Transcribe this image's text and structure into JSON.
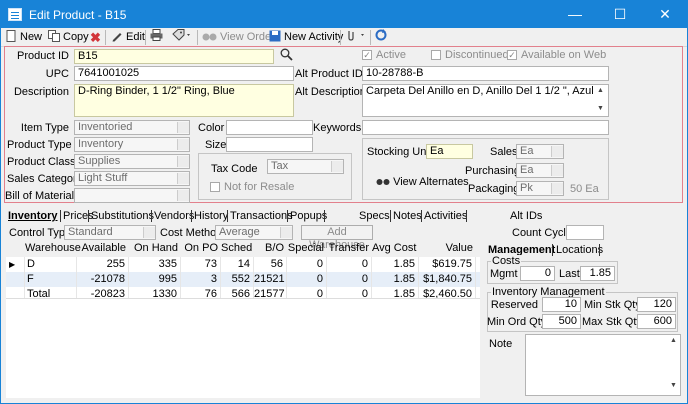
{
  "window": {
    "title": "Edit Product - B15",
    "minimize": "—",
    "maximize": "☐",
    "close": "✕"
  },
  "toolbar": {
    "new": "New",
    "copy": "Copy",
    "edit": "Edit",
    "view_order": "View Order",
    "new_activity": "New Activity"
  },
  "header": {
    "product_id_label": "Product ID",
    "product_id": "B15",
    "upc_label": "UPC",
    "upc": "7641001025",
    "description_label": "Description",
    "description": "D-Ring Binder, 1 1/2\" Ring, Blue",
    "active_label": "Active",
    "discontinued_label": "Discontinued",
    "available_web_label": "Available on Web",
    "alt_product_id_label": "Alt Product ID",
    "alt_product_id": "10-28788-B",
    "alt_description_label": "Alt Description",
    "alt_description": "Carpeta Del Anillo en D, Anillo Del 1 1/2 \", Azul",
    "item_type_label": "Item Type",
    "item_type": "Inventoried",
    "product_type_label": "Product Type",
    "product_type": "Inventory",
    "product_class_label": "Product Class",
    "product_class": "Supplies",
    "sales_category_label": "Sales Category",
    "sales_category": "Light Stuff",
    "bom_label": "Bill of Materials",
    "bom": "",
    "color_label": "Color",
    "color": "",
    "size_label": "Size",
    "size": "",
    "keywords_label": "Keywords",
    "keywords": "",
    "tax_code_label": "Tax Code",
    "tax_code": "Tax",
    "not_for_resale_label": "Not for Resale",
    "stocking_unit_label": "Stocking Unit",
    "stocking_unit": "Ea",
    "sales_label": "Sales",
    "sales_unit": "Ea",
    "purchasing_label": "Purchasing",
    "purchasing_unit": "Ea",
    "packaging_label": "Packaging",
    "packaging_unit": "Pk",
    "packaging_qty": "50 Ea",
    "view_alternates": "View Alternates"
  },
  "tabs": [
    "Inventory",
    "Prices",
    "Substitutions",
    "Vendors",
    "History",
    "Transactions",
    "Popups",
    "Specs",
    "Notes",
    "Activities",
    "Alt IDs"
  ],
  "inventory": {
    "control_type_label": "Control Type",
    "control_type": "Standard",
    "cost_method_label": "Cost Method",
    "cost_method": "Average",
    "add_warehouse": "Add Warehouse",
    "count_cycle_label": "Count Cycle",
    "count_cycle": "",
    "columns": [
      "Warehouse",
      "Available",
      "On Hand",
      "On PO",
      "Sched",
      "B/O",
      "Special",
      "Transfer",
      "Avg Cost",
      "Value"
    ],
    "rows": [
      {
        "marker": "▶",
        "warehouse": "D",
        "available": "255",
        "on_hand": "335",
        "on_po": "73",
        "sched": "14",
        "bo": "56",
        "special": "0",
        "transfer": "0",
        "avg_cost": "1.85",
        "value": "$619.75"
      },
      {
        "marker": "",
        "warehouse": "F",
        "available": "-21078",
        "on_hand": "995",
        "on_po": "3",
        "sched": "552",
        "bo": "21521",
        "special": "0",
        "transfer": "0",
        "avg_cost": "1.85",
        "value": "$1,840.75"
      },
      {
        "marker": "",
        "warehouse": "Total",
        "available": "-20823",
        "on_hand": "1330",
        "on_po": "76",
        "sched": "566",
        "bo": "21577",
        "special": "0",
        "transfer": "0",
        "avg_cost": "1.85",
        "value": "$2,460.50"
      }
    ]
  },
  "management": {
    "tab_management": "Management",
    "tab_locations": "Locations",
    "costs_label": "Costs",
    "mgmt_label": "Mgmt",
    "mgmt": "0",
    "last_label": "Last",
    "last": "1.85",
    "inv_mgmt_label": "Inventory Management",
    "reserved_label": "Reserved",
    "reserved": "10",
    "min_stk_label": "Min Stk Qty",
    "min_stk": "120",
    "min_ord_label": "Min Ord Qty",
    "min_ord": "500",
    "max_stk_label": "Max Stk Qty",
    "max_stk": "600",
    "note_label": "Note"
  }
}
